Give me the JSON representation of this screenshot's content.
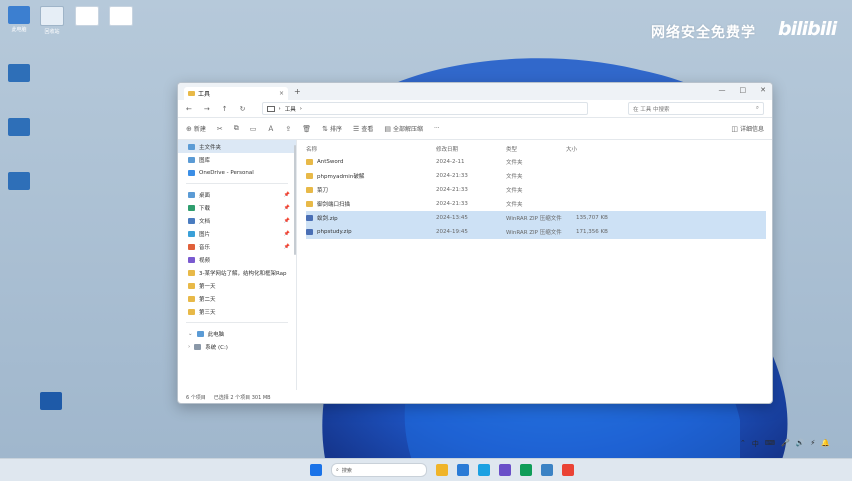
{
  "watermark": {
    "text": "网络安全免费学",
    "brand": "bilibili"
  },
  "desktop_icons": [
    {
      "label": "此电脑",
      "color": "#3c7fd0"
    },
    {
      "label": "回收站",
      "color": "#e6eef6"
    },
    {
      "label": "",
      "color": "#ffffff"
    },
    {
      "label": "",
      "color": "#ffffff"
    },
    {
      "label": "",
      "color": "#2e6fb8"
    },
    {
      "label": "",
      "color": "#2e6fb8"
    },
    {
      "label": "",
      "color": "#2e6fb8"
    },
    {
      "label": "",
      "color": "#1e5aa8"
    }
  ],
  "window": {
    "tab_title": "工具",
    "tab_close": "×",
    "new_tab": "+",
    "controls": {
      "minimize": "—",
      "maximize": "□",
      "close": "✕"
    },
    "nav": {
      "back": "←",
      "forward": "→",
      "up": "↑",
      "refresh": "↻"
    },
    "breadcrumb": {
      "sep": "›",
      "folder": "工具",
      "after": "›"
    },
    "search_placeholder": "在 工具 中搜索",
    "toolbar": {
      "new": "新建",
      "cut": "✂",
      "copy": "⧉",
      "paste": "▭",
      "rename": "Ａ",
      "share": "⇪",
      "delete": "🗑",
      "sort": "排序",
      "view": "查看",
      "extract": "全部解压缩",
      "more": "···",
      "details": "详细信息"
    },
    "nav_pane": [
      {
        "label": "主文件夹",
        "kind": "home",
        "selected": true,
        "pin": ""
      },
      {
        "label": "图库",
        "kind": "gallery",
        "selected": false,
        "pin": ""
      },
      {
        "label": "OneDrive - Personal",
        "kind": "cloud",
        "selected": false,
        "pin": ""
      },
      {
        "label": "桌面",
        "kind": "desktop",
        "selected": false,
        "pin": "📌"
      },
      {
        "label": "下载",
        "kind": "download",
        "selected": false,
        "pin": "📌"
      },
      {
        "label": "文档",
        "kind": "docs",
        "selected": false,
        "pin": "📌"
      },
      {
        "label": "图片",
        "kind": "pictures",
        "selected": false,
        "pin": "📌"
      },
      {
        "label": "音乐",
        "kind": "music",
        "selected": false,
        "pin": "📌"
      },
      {
        "label": "视频",
        "kind": "video",
        "selected": false,
        "pin": ""
      },
      {
        "label": "3-某学网站了解，结构化和框架Rap",
        "kind": "folder",
        "selected": false,
        "pin": ""
      },
      {
        "label": "第一天",
        "kind": "folder",
        "selected": false,
        "pin": ""
      },
      {
        "label": "第二天",
        "kind": "folder",
        "selected": false,
        "pin": ""
      },
      {
        "label": "第三天",
        "kind": "folder",
        "selected": false,
        "pin": ""
      },
      {
        "label": "此电脑",
        "kind": "pc",
        "selected": false,
        "pin": ""
      },
      {
        "label": "系统 (C:)",
        "kind": "drive",
        "selected": false,
        "pin": ""
      }
    ],
    "columns": {
      "name": "名称",
      "date": "修改日期",
      "type": "类型",
      "size": "大小"
    },
    "files": [
      {
        "name": "AntSword",
        "date": "2024-2-11",
        "type": "文件夹",
        "size": "",
        "kind": "folder",
        "selected": false
      },
      {
        "name": "phpmyadmin破解",
        "date": "2024-21:33",
        "type": "文件夹",
        "size": "",
        "kind": "folder",
        "selected": false
      },
      {
        "name": "菜刀",
        "date": "2024-21:33",
        "type": "文件夹",
        "size": "",
        "kind": "folder",
        "selected": false
      },
      {
        "name": "御剑端口扫描",
        "date": "2024-21:33",
        "type": "文件夹",
        "size": "",
        "kind": "folder",
        "selected": false
      },
      {
        "name": "蚁剑.zip",
        "date": "2024-13:45",
        "type": "WinRAR ZIP 压缩文件",
        "size": "135,707 KB",
        "kind": "zip",
        "selected": true
      },
      {
        "name": "phpstudy.zip",
        "date": "2024-19:45",
        "type": "WinRAR ZIP 压缩文件",
        "size": "171,356 KB",
        "kind": "zip",
        "selected": true
      }
    ],
    "status": {
      "count": "6 个项目",
      "selection": "已选择 2 个项目  301 MB"
    }
  },
  "taskbar": {
    "start_color": "#1a73e8",
    "search_label": "搜索",
    "apps": [
      "#f0b429",
      "#2b7bd6",
      "#1ba1e2",
      "#6a4fc8",
      "#0f9d58",
      "#3b82c4",
      "#ea4335"
    ],
    "tray": [
      "⌃",
      "中",
      "⌨",
      "🎤",
      "🔊",
      "⚡",
      "🔔"
    ]
  }
}
